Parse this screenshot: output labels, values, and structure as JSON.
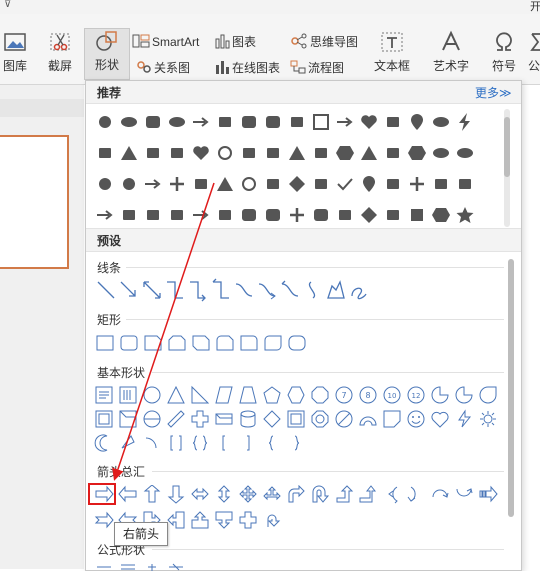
{
  "window": {
    "top_left_glyph": "⊽",
    "top_right_fragment": "开"
  },
  "ribbon": {
    "picture_label": "图库",
    "screenshot_label": "截屏",
    "shapes_label": "形状",
    "smartart_label": "SmartArt",
    "chart_label": "图表",
    "mindmap_label": "思维导图",
    "relation_label": "关系图",
    "online_chart_label": "在线图表",
    "flowchart_label": "流程图",
    "textbox_label": "文本框",
    "wordart_label": "艺术字",
    "symbol_label": "符号",
    "formula_label": "公"
  },
  "dropdown": {
    "recommend_title": "推荐",
    "more_label": "更多≫",
    "preset_title": "预设",
    "categories": {
      "lines": "线条",
      "rectangles": "矩形",
      "basic": "基本形状",
      "arrows": "箭头总汇",
      "formula": "公式形状"
    },
    "tooltip": "右箭头"
  },
  "colors": {
    "accent": "#2d6fc4",
    "highlight": "#e01b1b",
    "shape_outline": "#4a76b8",
    "dark_shape": "#555555"
  },
  "recommended_icons": [
    [
      "circle",
      "oval",
      "rounded-rect",
      "pill",
      "arrow-diag",
      "callout",
      "rounded-square",
      "rounded-rect",
      "people",
      "square-outline",
      "arrow-right-dashed",
      "heart",
      "crown",
      "teardrop",
      "oval",
      "lightning"
    ],
    [
      "people-row",
      "triangle",
      "globe",
      "phone",
      "heart-outline",
      "ring",
      "person",
      "house",
      "triangle",
      "parallelogram",
      "pentagon",
      "triangle-up",
      "book",
      "hexagon",
      "oval",
      "oval"
    ],
    [
      "sun",
      "circle",
      "arrow-right",
      "plus",
      "monitor",
      "triangle",
      "circle-outline",
      "tag",
      "diamond",
      "brace",
      "check",
      "pin",
      "question",
      "user-plus",
      "laptop",
      "chart"
    ],
    [
      "arrow-right",
      "corner",
      "line-chart",
      "chord",
      "arrow-up-right",
      "people",
      "rounded-square",
      "rounded-square",
      "user-add",
      "rounded-square",
      "hand",
      "diamond-flat",
      "edit",
      "square",
      "pentagon",
      "star"
    ]
  ]
}
